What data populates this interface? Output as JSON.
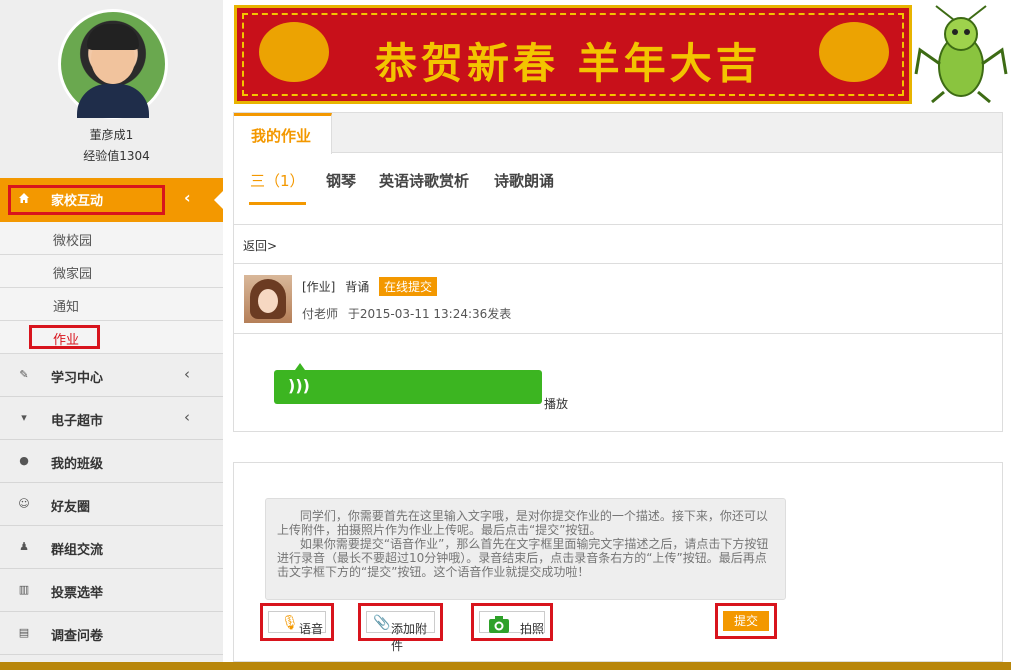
{
  "user": {
    "name": "董彦成1",
    "exp": "经验值1304"
  },
  "sidebar": {
    "active": {
      "label": "家校互动",
      "icon": "home-icon"
    },
    "subitems": [
      {
        "label": "微校园"
      },
      {
        "label": "微家园"
      },
      {
        "label": "通知"
      },
      {
        "label": "作业"
      }
    ],
    "items": [
      {
        "label": "学习中心",
        "icon": "edit-icon"
      },
      {
        "label": "电子超市",
        "icon": "cart-icon"
      },
      {
        "label": "我的班级",
        "icon": "user-icon"
      },
      {
        "label": "好友圈",
        "icon": "smile-icon"
      },
      {
        "label": "群组交流",
        "icon": "group-icon"
      },
      {
        "label": "投票选举",
        "icon": "bar-chart-icon"
      },
      {
        "label": "调查问卷",
        "icon": "file-icon"
      }
    ]
  },
  "banner": {
    "text": "恭贺新春 羊年大吉"
  },
  "homework": {
    "tab": "我的作业",
    "subjects": [
      "三（1）",
      "钢琴",
      "英语诗歌赏析",
      "诗歌朗诵"
    ],
    "back": "返回>",
    "post": {
      "type": "[作业]",
      "title": "背诵",
      "badge": "在线提交",
      "author": "付老师",
      "time": "于2015-03-11 13:24:36发表"
    },
    "voice_icon": "speaker-wave-icon",
    "play": "播放"
  },
  "submit_area": {
    "placeholder": "      同学们，你需要首先在这里输入文字哦，是对你提交作业的一个描述。接下来，你还可以上传附件，拍摄照片作为作业上传呢。最后点击“提交”按钮。\n      如果你需要提交“语音作业”，那么首先在文字框里面输完文字描述之后，请点击下方按钮进行录音（最长不要超过10分钟哦）。录音结束后，点击录音条右方的“上传”按钮。最后再点击文字框下方的“提交”按钮。这个语音作业就提交成功啦！",
    "voice": "语音",
    "attach": "添加附件",
    "photo": "拍照",
    "submit": "提交"
  }
}
